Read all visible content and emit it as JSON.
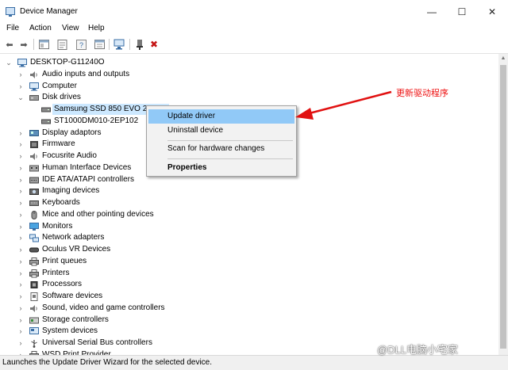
{
  "window": {
    "title": "Device Manager",
    "minimize_glyph": "—",
    "maximize_glyph": "☐",
    "close_glyph": "✕"
  },
  "menu": [
    "File",
    "Action",
    "View",
    "Help"
  ],
  "toolbar": {
    "icons": [
      "back-icon",
      "forward-icon",
      "show-hide-console-icon",
      "properties-icon",
      "help-icon",
      "update-driver-icon",
      "scan-hardware-icon",
      "add-driver-icon",
      "uninstall-icon"
    ],
    "glyphs": {
      "back": "⬅",
      "forward": "➡",
      "uninstall": "✖"
    }
  },
  "tree": {
    "root": "DESKTOP-G11240O",
    "items": [
      {
        "label": "Audio inputs and outputs",
        "icon": "speaker-icon",
        "expanded": false
      },
      {
        "label": "Computer",
        "icon": "computer-icon",
        "expanded": false
      },
      {
        "label": "Disk drives",
        "icon": "disk-drive-icon",
        "expanded": true,
        "children": [
          {
            "label": "Samsung SSD 850 EVO 250GB",
            "selected": true
          },
          {
            "label": "ST1000DM010-2EP102",
            "selected": false
          }
        ]
      },
      {
        "label": "Display adaptors",
        "icon": "display-adapter-icon",
        "expanded": false
      },
      {
        "label": "Firmware",
        "icon": "firmware-icon",
        "expanded": false
      },
      {
        "label": "Focusrite Audio",
        "icon": "speaker-icon",
        "expanded": false
      },
      {
        "label": "Human Interface Devices",
        "icon": "hid-icon",
        "expanded": false
      },
      {
        "label": "IDE ATA/ATAPI controllers",
        "icon": "ide-icon",
        "expanded": false
      },
      {
        "label": "Imaging devices",
        "icon": "camera-icon",
        "expanded": false
      },
      {
        "label": "Keyboards",
        "icon": "keyboard-icon",
        "expanded": false
      },
      {
        "label": "Mice and other pointing devices",
        "icon": "mouse-icon",
        "expanded": false
      },
      {
        "label": "Monitors",
        "icon": "monitor-icon",
        "expanded": false
      },
      {
        "label": "Network adapters",
        "icon": "network-icon",
        "expanded": false
      },
      {
        "label": "Oculus VR Devices",
        "icon": "vr-icon",
        "expanded": false
      },
      {
        "label": "Print queues",
        "icon": "printer-icon",
        "expanded": false
      },
      {
        "label": "Printers",
        "icon": "printer-icon",
        "expanded": false
      },
      {
        "label": "Processors",
        "icon": "processor-icon",
        "expanded": false
      },
      {
        "label": "Software devices",
        "icon": "software-device-icon",
        "expanded": false
      },
      {
        "label": "Sound, video and game controllers",
        "icon": "speaker-icon",
        "expanded": false
      },
      {
        "label": "Storage controllers",
        "icon": "storage-icon",
        "expanded": false
      },
      {
        "label": "System devices",
        "icon": "system-icon",
        "expanded": false
      },
      {
        "label": "Universal Serial Bus controllers",
        "icon": "usb-icon",
        "expanded": false
      },
      {
        "label": "WSD Print Provider",
        "icon": "printer-icon",
        "expanded": false
      }
    ]
  },
  "context_menu": {
    "items": [
      {
        "label": "Update driver",
        "highlighted": true,
        "bold": false
      },
      {
        "label": "Uninstall device",
        "highlighted": false,
        "bold": false
      },
      {
        "label": "Scan for hardware changes",
        "highlighted": false,
        "bold": false
      },
      {
        "label": "Properties",
        "highlighted": false,
        "bold": true
      }
    ]
  },
  "annotation": {
    "text": "更新驱动程序",
    "color": "#e11111"
  },
  "status": "Launches the Update Driver Wizard for the selected device.",
  "watermark": "@DLL电脑小宅家",
  "colors": {
    "selection": "#cce8ff",
    "menu_highlight": "#91c9f7",
    "annotation": "#e11111",
    "icon_blue": "#3a6ea5"
  }
}
